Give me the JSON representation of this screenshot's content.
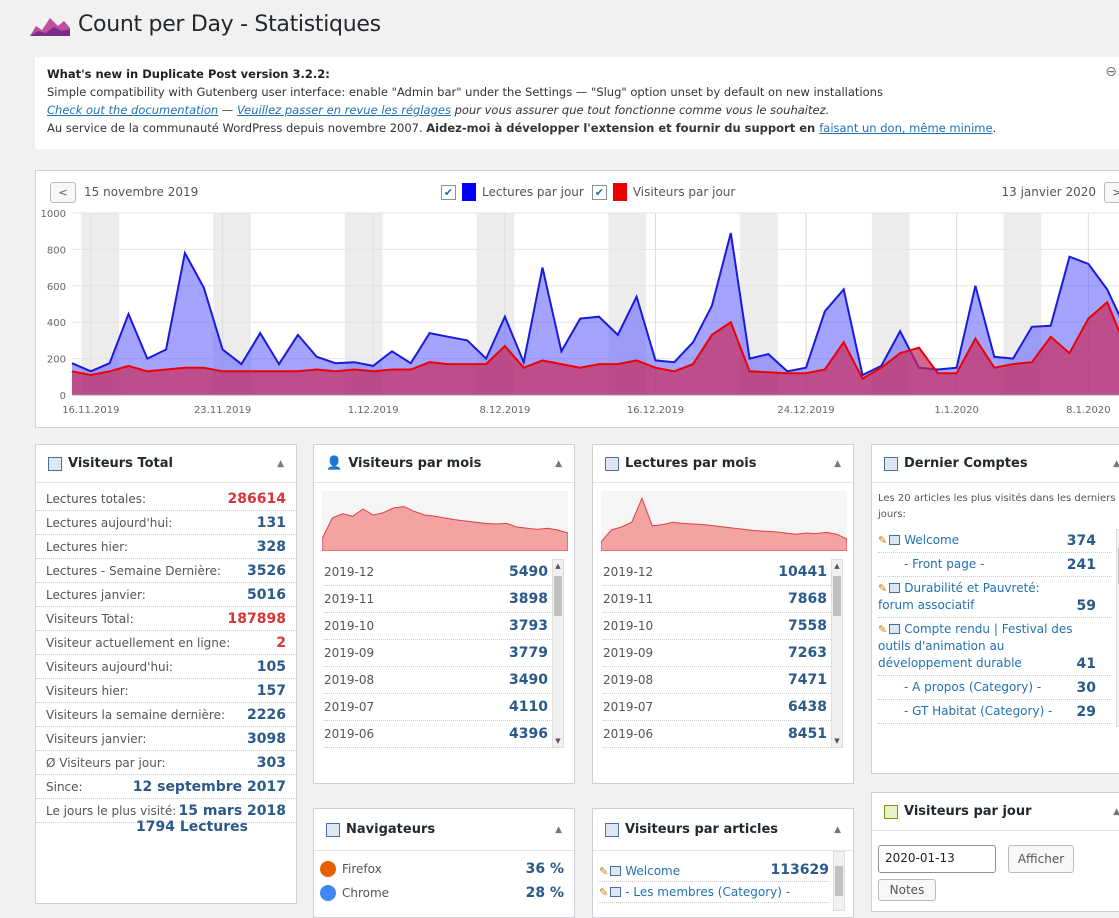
{
  "title": "Count per Day - Statistiques",
  "notice": {
    "heading": "What's new in Duplicate Post version 3.2.2:",
    "line1": "Simple compatibility with Gutenberg user interface: enable \"Admin bar\" under the Settings — \"Slug\" option unset by default on new installations",
    "doc_link": "Check out the documentation",
    "sep": " — ",
    "review_link": "Veuillez passer en revue les réglages",
    "line2_rest": " pour vous assurer que tout fonctionne comme vous le souhaitez.",
    "line3_a": "Au service de la communauté WordPress depuis novembre 2007. ",
    "line3_b": "Aidez-moi à développer l'extension et fournir du support en ",
    "donate_link": "faisant un don, même minime",
    "line3_end": "."
  },
  "chart": {
    "prev": "<",
    "next": ">",
    "start_date": "15 novembre 2019",
    "end_date": "13 janvier 2020",
    "legend_reads": "Lectures par jour",
    "legend_visitors": "Visiteurs par jour",
    "color_reads": "#0000ff",
    "color_visitors": "#ee0000"
  },
  "chart_data": {
    "type": "area",
    "ylim": [
      0,
      1000
    ],
    "yticks": [
      "0",
      "200",
      "400",
      "600",
      "800",
      "1000"
    ],
    "xticks": [
      "16.11.2019",
      "23.11.2019",
      "1.12.2019",
      "8.12.2019",
      "16.12.2019",
      "24.12.2019",
      "1.1.2020",
      "8.1.2020"
    ],
    "xtick_index": [
      1,
      8,
      16,
      23,
      31,
      39,
      47,
      54
    ],
    "series": [
      {
        "name": "Lectures par jour",
        "values": [
          175,
          130,
          175,
          445,
          200,
          250,
          780,
          590,
          250,
          170,
          340,
          170,
          330,
          210,
          175,
          180,
          160,
          240,
          175,
          340,
          320,
          300,
          200,
          430,
          180,
          700,
          240,
          420,
          430,
          330,
          540,
          190,
          180,
          290,
          490,
          890,
          200,
          225,
          130,
          150,
          460,
          580,
          110,
          160,
          350,
          150,
          140,
          150,
          600,
          210,
          200,
          375,
          380,
          760,
          720,
          580,
          360
        ]
      },
      {
        "name": "Visiteurs par jour",
        "values": [
          130,
          110,
          130,
          160,
          130,
          140,
          150,
          150,
          130,
          130,
          130,
          130,
          130,
          140,
          130,
          140,
          130,
          140,
          140,
          180,
          170,
          170,
          170,
          270,
          150,
          190,
          170,
          150,
          170,
          170,
          190,
          150,
          130,
          170,
          330,
          400,
          130,
          125,
          120,
          120,
          140,
          290,
          90,
          150,
          230,
          260,
          120,
          120,
          310,
          150,
          170,
          180,
          320,
          230,
          420,
          510,
          260
        ]
      }
    ]
  },
  "visiteurs_total": {
    "title": "Visiteurs Total",
    "rows": [
      {
        "label": "Lectures totales:",
        "value": "286614",
        "red": true
      },
      {
        "label": "Lectures aujourd'hui:",
        "value": "131"
      },
      {
        "label": "Lectures hier:",
        "value": "328"
      },
      {
        "label": "Lectures - Semaine Dernière:",
        "value": "3526"
      },
      {
        "label": "Lectures janvier:",
        "value": "5016"
      },
      {
        "label": "Visiteurs Total:",
        "value": "187898",
        "red": true
      },
      {
        "label": "Visiteur actuellement en ligne:",
        "value": "2",
        "red": true
      },
      {
        "label": "Visiteurs aujourd'hui:",
        "value": "105"
      },
      {
        "label": "Visiteurs hier:",
        "value": "157"
      },
      {
        "label": "Visiteurs la semaine dernière:",
        "value": "2226"
      },
      {
        "label": "Visiteurs janvier:",
        "value": "3098"
      },
      {
        "label": "Ø Visiteurs par jour:",
        "value": "303"
      },
      {
        "label": "Since:",
        "value": "12 septembre 2017"
      },
      {
        "label": "Le jours le plus visité:",
        "value": "15 mars 2018"
      }
    ],
    "extra": "1794 Lectures"
  },
  "visiteurs_mois": {
    "title": "Visiteurs par mois",
    "rows": [
      {
        "m": "2019-12",
        "v": "5490"
      },
      {
        "m": "2019-11",
        "v": "3898"
      },
      {
        "m": "2019-10",
        "v": "3793"
      },
      {
        "m": "2019-09",
        "v": "3779"
      },
      {
        "m": "2019-08",
        "v": "3490"
      },
      {
        "m": "2019-07",
        "v": "4110"
      },
      {
        "m": "2019-06",
        "v": "4396"
      }
    ],
    "spark": [
      20,
      55,
      62,
      58,
      70,
      60,
      64,
      72,
      74,
      66,
      60,
      58,
      55,
      52,
      50,
      48,
      46,
      45,
      46,
      40,
      38,
      36,
      38,
      35,
      30
    ]
  },
  "lectures_mois": {
    "title": "Lectures par mois",
    "rows": [
      {
        "m": "2019-12",
        "v": "10441"
      },
      {
        "m": "2019-11",
        "v": "7868"
      },
      {
        "m": "2019-10",
        "v": "7558"
      },
      {
        "m": "2019-09",
        "v": "7263"
      },
      {
        "m": "2019-08",
        "v": "7471"
      },
      {
        "m": "2019-07",
        "v": "6438"
      },
      {
        "m": "2019-06",
        "v": "8451"
      }
    ],
    "spark": [
      15,
      35,
      40,
      48,
      88,
      42,
      44,
      48,
      46,
      45,
      44,
      42,
      40,
      38,
      36,
      34,
      33,
      32,
      30,
      28,
      30,
      29,
      31,
      28,
      20
    ]
  },
  "dernier": {
    "title": "Dernier Comptes",
    "desc": "Les 20 articles les plus visités dans les derniers 7 jours:",
    "items": [
      {
        "label": "Welcome",
        "value": "374",
        "pencil": true
      },
      {
        "label": "- Front page -",
        "value": "241",
        "indent": true
      },
      {
        "label": "Durabilité et Pauvreté: forum associatif",
        "value": "59",
        "pencil": true
      },
      {
        "label": "Compte rendu | Festival des outils d'animation au développement durable",
        "value": "41",
        "pencil": true
      },
      {
        "label": "- A propos (Category) -",
        "value": "30",
        "indent": true
      },
      {
        "label": "- GT Habitat (Category) -",
        "value": "29",
        "indent": true
      }
    ]
  },
  "visiteurs_jour": {
    "title": "Visiteurs par jour",
    "date_value": "2020-01-13",
    "button": "Afficher",
    "notes": "Notes"
  },
  "navigateurs": {
    "title": "Navigateurs",
    "items": [
      {
        "name": "Firefox",
        "value": "36 %"
      },
      {
        "name": "Chrome",
        "value": "28 %"
      }
    ]
  },
  "visiteurs_articles": {
    "title": "Visiteurs par articles",
    "items": [
      {
        "label": "Welcome",
        "value": "113629"
      },
      {
        "label": "- Les membres (Category) -",
        "value": ""
      }
    ]
  }
}
